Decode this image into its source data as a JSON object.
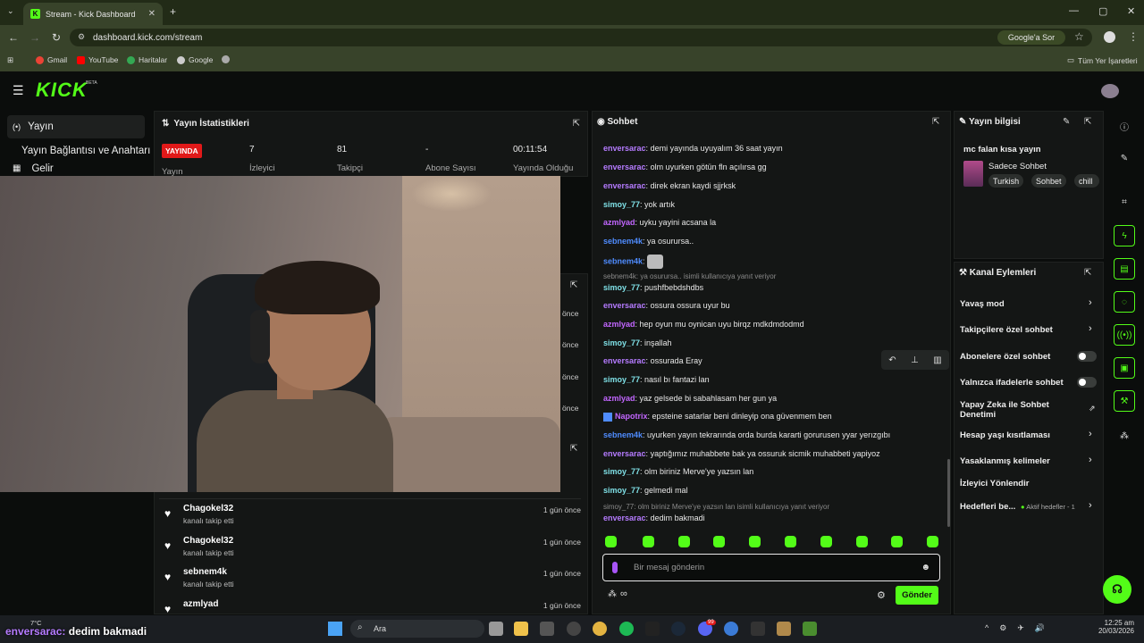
{
  "browser": {
    "tab_title": "Stream - Kick Dashboard",
    "url": "dashboard.kick.com/stream",
    "google_sor": "Google'a Sor",
    "bookmarks": [
      "Gmail",
      "YouTube",
      "Haritalar",
      "Google"
    ],
    "all_bookmarks": "Tüm Yer İşaretleri"
  },
  "app": {
    "logo": "KICK",
    "logo_badge": "BETA"
  },
  "sidebar": {
    "items": [
      {
        "icon": "(•)",
        "label": "Yayın"
      },
      {
        "icon": "",
        "label": "Yayın Bağlantısı ve Anahtarı"
      },
      {
        "icon": "▦",
        "label": "Gelir"
      }
    ]
  },
  "stats": {
    "title": "Yayın İstatistikleri",
    "live_badge": "YAYINDA",
    "status_label": "Yayın",
    "values": [
      {
        "value": "7",
        "label": "İzleyici"
      },
      {
        "value": "81",
        "label": "Takipçi"
      },
      {
        "value": "-",
        "label": "Abone Sayısı"
      },
      {
        "value": "00:11:54",
        "label": "Yayında Olduğu"
      }
    ]
  },
  "events": {
    "partial_times": [
      "önce",
      "önce",
      "önce",
      "önce"
    ],
    "items": [
      {
        "name": "Chagokel32",
        "action": "kanalı takip etti",
        "time": "1 gün önce"
      },
      {
        "name": "Chagokel32",
        "action": "kanalı takip etti",
        "time": "1 gün önce"
      },
      {
        "name": "sebnem4k",
        "action": "kanalı takip etti",
        "time": "1 gün önce"
      },
      {
        "name": "azmlyad",
        "action": "",
        "time": "1 gün önce"
      }
    ]
  },
  "chat": {
    "title": "Sohbet",
    "messages": [
      {
        "user": "enversarac",
        "color": "#b57bff",
        "text": "demi yayında uyuyalım 36 saat yayın"
      },
      {
        "user": "enversarac",
        "color": "#b57bff",
        "text": "olm uyurken götün fln açılırsa gg"
      },
      {
        "user": "enversarac",
        "color": "#b57bff",
        "text": "direk ekran kaydi sjjrksk"
      },
      {
        "user": "simoy_77",
        "color": "#7fe0e6",
        "text": "yok artık"
      },
      {
        "user": "azmlyad",
        "color": "#c266ff",
        "text": "uyku yayini acsana la"
      },
      {
        "user": "sebnem4k",
        "color": "#4f8cff",
        "text": "ya osurursa.."
      },
      {
        "user": "sebnem4k",
        "color": "#4f8cff",
        "text": ""
      },
      {
        "user": "simoy_77",
        "color": "#7fe0e6",
        "text": "pushfbebdshdbs"
      },
      {
        "user": "enversarac",
        "color": "#b57bff",
        "text": "ossura ossura uyur bu"
      },
      {
        "user": "azmlyad",
        "color": "#c266ff",
        "text": "hep oyun mu oynican uyu birqz mdkdmdodmd"
      },
      {
        "user": "simoy_77",
        "color": "#7fe0e6",
        "text": "inşallah"
      },
      {
        "user": "enversarac",
        "color": "#b57bff",
        "text": "ossurada Eray"
      },
      {
        "user": "simoy_77",
        "color": "#7fe0e6",
        "text": "nasıl bı fantazi lan"
      },
      {
        "user": "azmlyad",
        "color": "#c266ff",
        "text": "yaz gelsede bi sabahlasam her gun ya"
      },
      {
        "user": "Napotrix",
        "color": "#c266ff",
        "text": "epsteine satarlar beni dinleyip ona güvenmem ben"
      },
      {
        "user": "sebnem4k",
        "color": "#4f8cff",
        "text": "uyurken yayın tekrarında orda burda kararti gorurusen yyar yerızgıbı"
      },
      {
        "user": "enversarac",
        "color": "#b57bff",
        "text": "yaptığımız muhabbete bak ya ossuruk sicmik muhabbeti yapiyoz"
      },
      {
        "user": "simoy_77",
        "color": "#7fe0e6",
        "text": "olm biriniz Merve'ye yazsın lan"
      },
      {
        "user": "simoy_77",
        "color": "#7fe0e6",
        "text": "gelmedi mal"
      },
      {
        "user": "enversarac",
        "color": "#b57bff",
        "text": "dedim bakmadi"
      }
    ],
    "reply_1": "sebnem4k: ya osurursa.. isimli kullanıcıya yanıt veriyor",
    "reply_2": "simoy_77: olm biriniz Merve'ye yazsın lan isimli kullanıcıya yanıt veriyor",
    "input_placeholder": "Bir mesaj gönderin",
    "send_label": "Gönder",
    "infinity": "∞"
  },
  "stream_info": {
    "title": "Yayın bilgisi",
    "stream_title": "mc falan kısa yayın",
    "category": "Sadece Sohbet",
    "tags": [
      "Turkish",
      "Sohbet",
      "chill"
    ]
  },
  "channel_actions": {
    "title": "Kanal Eylemleri",
    "slow_mode": "Yavaş mod",
    "followers_only": "Takipçilere özel sohbet",
    "subscribers_only": "Abonelere özel sohbet",
    "emotes_only": "Yalnızca ifadelerle sohbet",
    "ai_moderation": "Yapay Zeka ile Sohbet Denetimi",
    "account_age": "Hesap yaşı kısıtlaması",
    "banned_words": "Yasaklanmış kelimeler",
    "viewer_redirect": "İzleyici Yönlendir",
    "goals": "Hedefleri be...",
    "goals_status": "Aktif hedefler - 1"
  },
  "taskbar": {
    "weather": "7°C",
    "search": "Ara",
    "time": "12:25 am",
    "date": "20/03/2026",
    "overlay_user": "enversarac:",
    "overlay_text": "dedim bakmadi",
    "badge": "99"
  }
}
